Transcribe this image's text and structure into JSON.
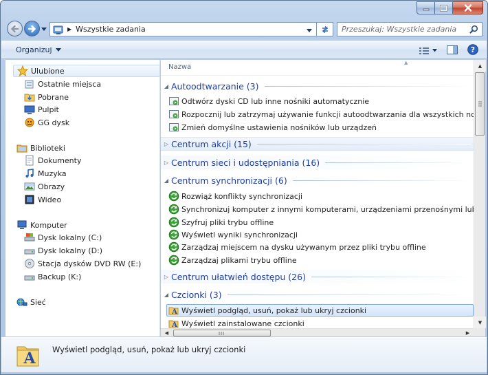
{
  "window": {
    "title": ""
  },
  "address": {
    "crumb": "Wszystkie zadania"
  },
  "search": {
    "placeholder": "Przeszukaj: Wszystkie zadania"
  },
  "toolbar": {
    "organize_label": "Organizuj"
  },
  "content": {
    "column_header": "Nazwa",
    "groups": [
      {
        "title": "Autoodtwarzanie (3)",
        "expanded": true,
        "tasks": [
          "Odtwórz dyski CD lub inne nośniki automatycznie",
          "Rozpocznij lub zatrzymaj używanie funkcji autoodtwarzania dla wszystkich nośników i urządzeń",
          "Zmień domyślne ustawienia nośników lub urządzeń"
        ]
      },
      {
        "title": "Centrum akcji (15)",
        "expanded": false
      },
      {
        "title": "Centrum sieci i udostępniania (16)",
        "expanded": false
      },
      {
        "title": "Centrum synchronizacji (6)",
        "expanded": true,
        "tasks": [
          "Rozwiąż konflikty synchronizacji",
          "Synchronizuj komputer z innymi komputerami, urządzeniami przenośnymi lub folderami sieciowymi",
          "Szyfruj pliki trybu offline",
          "Wyświetl wyniki synchronizacji",
          "Zarządzaj miejscem na dysku używanym przez pliki trybu offline",
          "Zarządzaj plikami trybu offline"
        ]
      },
      {
        "title": "Centrum ułatwień dostępu (26)",
        "expanded": false
      },
      {
        "title": "Czcionki (3)",
        "expanded": true,
        "tasks": [
          "Wyświetl podgląd, usuń, pokaż lub ukryj czcionki",
          "Wyświetl zainstalowane czcionki"
        ]
      }
    ]
  },
  "navpane": {
    "favorites": {
      "label": "Ulubione",
      "items": [
        "Ostatnie miejsca",
        "Pobrane",
        "Pulpit",
        "GG dysk"
      ]
    },
    "libraries": {
      "label": "Biblioteki",
      "items": [
        "Dokumenty",
        "Muzyka",
        "Obrazy",
        "Wideo"
      ]
    },
    "computer": {
      "label": "Komputer",
      "items": [
        "Dysk lokalny (C:)",
        "Dysk lokalny (D:)",
        "Stacja dysków DVD RW (E:)",
        "Backup (K:)"
      ]
    },
    "network": {
      "label": "Sieć"
    }
  },
  "details": {
    "text": "Wyświetl podgląd, usuń, pokaż lub ukryj czcionki"
  },
  "icons": {
    "back": "back-arrow-icon",
    "forward": "forward-arrow-icon",
    "refresh": "refresh-icon",
    "search": "search-icon",
    "help": "help-icon",
    "views": "view-options-icon",
    "preview": "preview-pane-icon"
  },
  "colors": {
    "group_title": "#1e3da3",
    "accent": "#2464b8"
  }
}
